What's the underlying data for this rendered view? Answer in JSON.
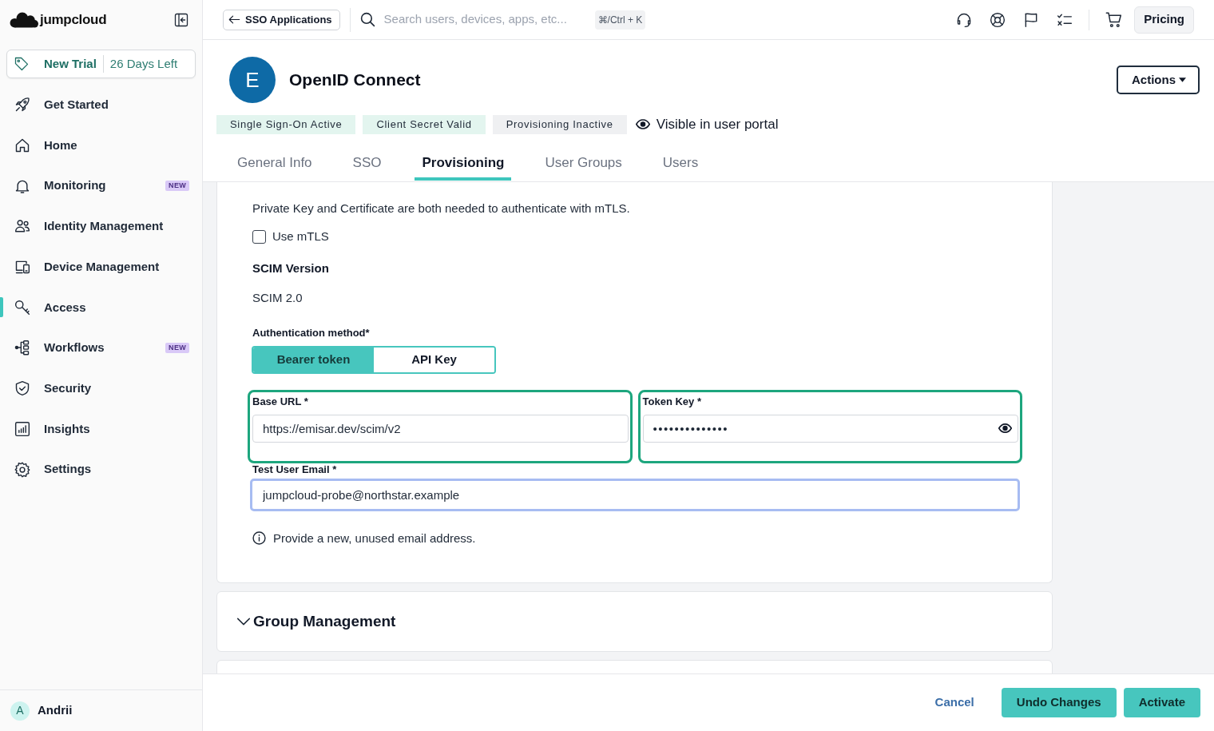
{
  "sidebar": {
    "logo": "jumpcloud",
    "trial": {
      "label": "New Trial",
      "remaining": "26 Days Left"
    },
    "items": [
      {
        "label": "Get Started",
        "selected": false
      },
      {
        "label": "Home",
        "selected": false
      },
      {
        "label": "Monitoring",
        "selected": false,
        "badge": "NEW"
      },
      {
        "label": "Identity Management",
        "selected": false
      },
      {
        "label": "Device Management",
        "selected": false
      },
      {
        "label": "Access",
        "selected": true
      },
      {
        "label": "Workflows",
        "selected": false,
        "badge": "NEW"
      },
      {
        "label": "Security",
        "selected": false
      },
      {
        "label": "Insights",
        "selected": false
      },
      {
        "label": "Settings",
        "selected": false
      }
    ],
    "user": {
      "initial": "A",
      "name": "Andrii"
    }
  },
  "topbar": {
    "back_button": "SSO Applications",
    "search": {
      "placeholder": "Search users, devices, apps, etc...",
      "shortcut": "⌘/Ctrl + K"
    },
    "pricing_button": "Pricing"
  },
  "app": {
    "initial": "E",
    "name": "OpenID Connect",
    "actions_button": "Actions",
    "statuses": [
      {
        "label": "Single Sign-On Active",
        "color": "#e3f5ef"
      },
      {
        "label": "Client Secret Valid",
        "color": "#e3f5ef"
      },
      {
        "label": "Provisioning Inactive",
        "color": "#eff0f2"
      }
    ],
    "visibility": "Visible in user portal"
  },
  "tabs": [
    {
      "label": "General Info",
      "selected": false
    },
    {
      "label": "SSO",
      "selected": false
    },
    {
      "label": "Provisioning",
      "selected": true
    },
    {
      "label": "User Groups",
      "selected": false
    },
    {
      "label": "Users",
      "selected": false
    }
  ],
  "provisioning": {
    "note": "Private Key and Certificate are both needed to authenticate with mTLS.",
    "mtls": {
      "label": "Use mTLS",
      "checked": false
    },
    "scim_version": {
      "label": "SCIM Version",
      "value": "SCIM 2.0"
    },
    "auth_method": {
      "label": "Authentication method*",
      "options": [
        {
          "label": "Bearer token",
          "selected": true
        },
        {
          "label": "API Key",
          "selected": false
        }
      ]
    },
    "fields": [
      {
        "kind": "text",
        "label": "Base URL *",
        "value": "https://emisar.dev/scim/v2",
        "highlighted": true,
        "focused": false
      },
      {
        "kind": "secret",
        "label": "Token Key *",
        "value": "••••••••••••••",
        "highlighted": true,
        "focused": false
      },
      {
        "kind": "text",
        "label": "Test User Email *",
        "value": "jumpcloud-probe@northstar.example",
        "highlighted": false,
        "focused": true
      }
    ],
    "hint": "Provide a new, unused email address."
  },
  "sections": [
    {
      "title": "Group Management"
    }
  ],
  "footer": {
    "cancel": "Cancel",
    "undo": "Undo Changes",
    "activate": "Activate"
  }
}
